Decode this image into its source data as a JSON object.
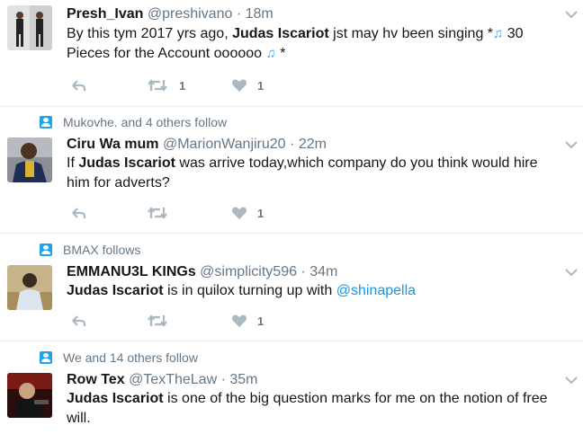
{
  "colors": {
    "link": "#1b95e0",
    "muted": "#657786",
    "text": "#14171a",
    "accent": "#1da1f2"
  },
  "tweets": [
    {
      "context": "",
      "name": "Presh_Ivan",
      "handle": "@preshivano",
      "dot": "·",
      "time": "18m",
      "body": [
        {
          "t": "By this tym 2017 yrs ago,  "
        },
        {
          "t": "Judas Iscariot",
          "b": 1
        },
        {
          "t": " jst may hv been singing   *"
        },
        {
          "t": "♫",
          "n": 1
        },
        {
          "t": " 30 Pieces for the Account oooooo "
        },
        {
          "t": "♫",
          "n": 1
        },
        {
          "t": " *"
        }
      ],
      "retweets": "1",
      "likes": "1",
      "avatar_icon": "man-in-suit-avatar"
    },
    {
      "context": "Mukovhe. and 4 others follow",
      "name": "Ciru Wa mum",
      "handle": "@MarionWanjiru20",
      "dot": "·",
      "time": "22m",
      "body": [
        {
          "t": "If "
        },
        {
          "t": "Judas Iscariot",
          "b": 1
        },
        {
          "t": " was arrive today,which company do you think would hire him for adverts?"
        }
      ],
      "retweets": "",
      "likes": "1",
      "avatar_icon": "person-avatar"
    },
    {
      "context": "BMAX follows",
      "name": "EMMANU3L KINGs",
      "handle": "@simplicity596",
      "dot": "·",
      "time": "34m",
      "body": [
        {
          "t": "Judas Iscariot",
          "b": 1
        },
        {
          "t": " is in quilox turning up with "
        },
        {
          "t": "@shinapella",
          "m": 1
        }
      ],
      "retweets": "",
      "likes": "1",
      "avatar_icon": "man-outdoors-avatar"
    },
    {
      "context": "We and 14 others follow",
      "name": "Row Tex",
      "handle": "@TexTheLaw",
      "dot": "·",
      "time": "35m",
      "body": [
        {
          "t": "Judas Iscariot",
          "b": 1
        },
        {
          "t": " is one of the big question marks for me on the notion of free will."
        }
      ],
      "retweets": "",
      "likes": "",
      "avatar_icon": "scarface-avatar"
    }
  ]
}
